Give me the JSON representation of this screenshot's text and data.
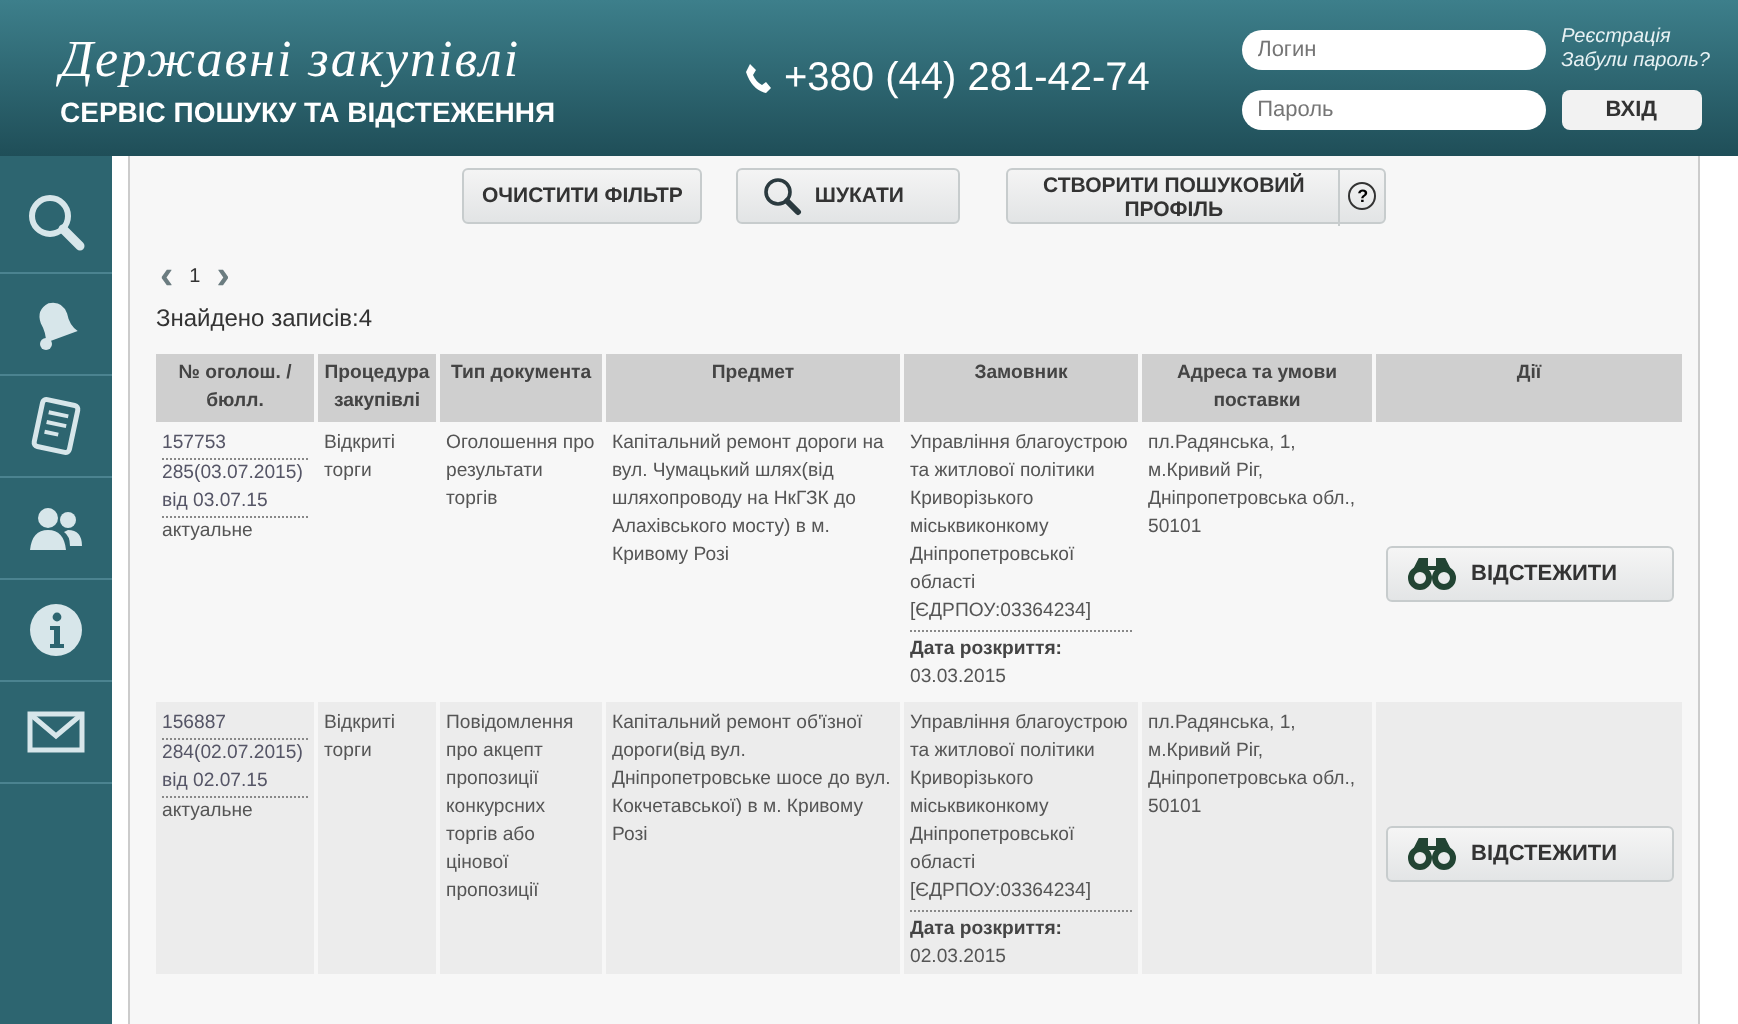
{
  "header": {
    "title": "Державні закупівлі",
    "subtitle": "СЕРВІС ПОШУКУ ТА ВІДСТЕЖЕННЯ",
    "phone": "+380 (44) 281-42-74",
    "login_placeholder": "Логин",
    "password_placeholder": "Пароль",
    "register_link": "Реєстрація",
    "forgot_link": "Забули пароль?",
    "login_button": "ВХІД"
  },
  "sidebar": {
    "items": [
      {
        "kind": "search"
      },
      {
        "kind": "bell"
      },
      {
        "kind": "document"
      },
      {
        "kind": "people"
      },
      {
        "kind": "info"
      },
      {
        "kind": "mail"
      }
    ]
  },
  "toolbar": {
    "clear_button": "ОЧИСТИТИ ФІЛЬТР",
    "search_button": "ШУКАТИ",
    "profile_button": "СТВОРИТИ ПОШУКОВИЙ ПРОФІЛЬ",
    "help": "?"
  },
  "pagination": {
    "prev": "‹",
    "pages": [
      {
        "label": "1",
        "selected": true
      }
    ],
    "next": "›"
  },
  "found": "Знайдено записів:4",
  "table": {
    "columns": [
      "№ оголош. / бюлл.",
      "Процедура закупівлі",
      "Тип документа",
      "Предмет",
      "Замовник",
      "Адреса та умови поставки",
      "Дії"
    ],
    "rows": [
      {
        "number": "157753",
        "bulletin": "285(03.07.2015)",
        "bulletin_date": "від 03.07.15",
        "status": "актуальне",
        "procedure": "Відкриті торги",
        "doc_type": "Оголошення про результати торгів",
        "subject": "Капітальний ремонт дороги на вул. Чумацький шлях(від шляхопроводу на НкГЗК до Алахівського мосту) в м. Кривому Розі",
        "customer": "Управління благоустрою та житлової політики Криворізького міськвиконкому Дніпропетровської області [ЄДРПОУ:03364234]",
        "opening_label": "Дата розкриття:",
        "opening_date": "03.03.2015",
        "address": "пл.Радянська, 1, м.Кривий Ріг, Дніпропетровська обл., 50101",
        "action": "ВІДСТЕЖИТИ"
      },
      {
        "number": "156887",
        "bulletin": "284(02.07.2015)",
        "bulletin_date": "від 02.07.15",
        "status": "актуальне",
        "procedure": "Відкриті торги",
        "doc_type": "Повідомлення про акцепт пропозиції конкурсних торгів або цінової пропозиції",
        "subject": "Капітальний ремонт об'їзної дороги(від вул. Дніпропетровське шосе до вул. Кокчетавської) в м. Кривому Розі",
        "customer": "Управління благоустрою та житлової політики Криворізького міськвиконкому Дніпропетровської області [ЄДРПОУ:03364234]",
        "opening_label": "Дата розкриття:",
        "opening_date": "02.03.2015",
        "address": "пл.Радянська, 1, м.Кривий Ріг, Дніпропетровська обл., 50101",
        "action": "ВІДСТЕЖИТИ"
      }
    ]
  }
}
